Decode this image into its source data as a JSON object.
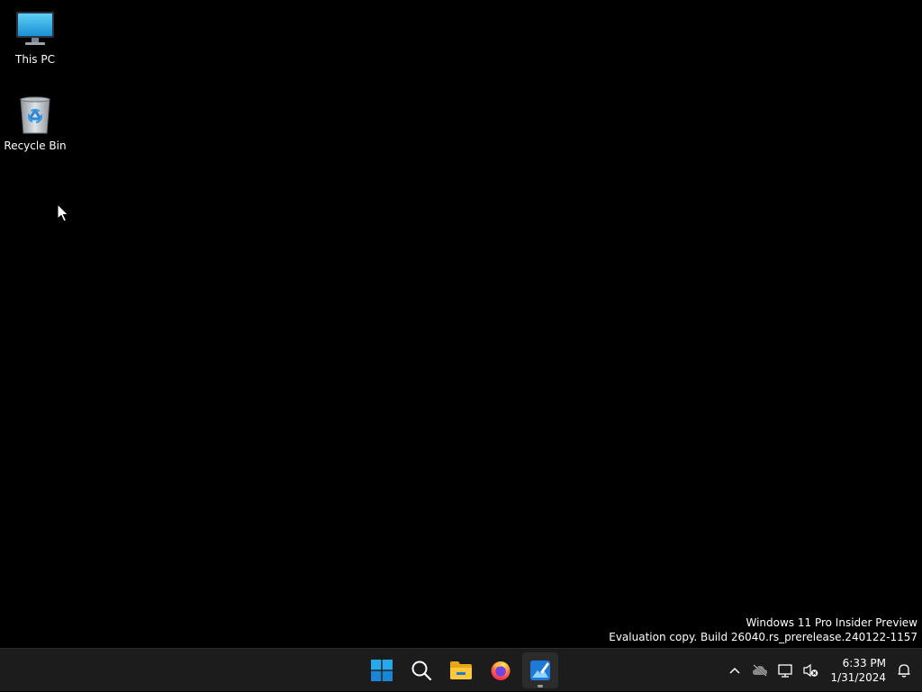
{
  "desktop": {
    "icons": [
      {
        "label": "This PC",
        "icon": "monitor-icon"
      },
      {
        "label": "Recycle Bin",
        "icon": "recycle-bin-icon"
      }
    ]
  },
  "watermark": {
    "line1": "Windows 11 Pro Insider Preview",
    "line2": "Evaluation copy. Build 26040.rs_prerelease.240122-1157"
  },
  "taskbar": {
    "apps": [
      {
        "name": "Start",
        "icon": "windows-logo-icon"
      },
      {
        "name": "Search",
        "icon": "search-icon"
      },
      {
        "name": "File Explorer",
        "icon": "folder-icon"
      },
      {
        "name": "Firefox",
        "icon": "firefox-icon"
      },
      {
        "name": "Paint",
        "icon": "paint-icon",
        "running": true
      }
    ],
    "tray": {
      "icons": [
        "chevron-up-icon",
        "cloud-offline-icon",
        "network-icon",
        "volume-muted-icon",
        "notification-bell-icon"
      ],
      "time": "6:33 PM",
      "date": "1/31/2024"
    }
  },
  "colors": {
    "desktop_bg": "#000000",
    "taskbar_bg": "#1c1c1c",
    "accent": "#0078d4"
  }
}
